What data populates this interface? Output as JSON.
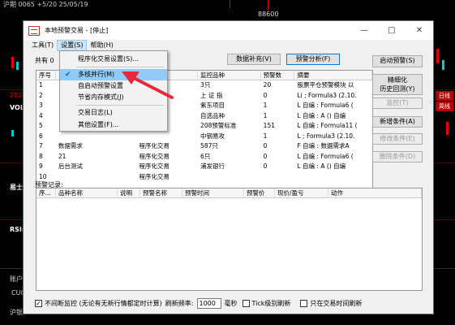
{
  "background": {
    "top_text": "沪期 0065 +5/20 25/05/19",
    "price": "88600",
    "label_2023": "2023",
    "vol_label": "VOL(",
    "ji_label": "易士1",
    "rsi_label": "RSI(",
    "zh_label": "账户拦",
    "cu_label": "CU06",
    "hu_label": "沪银2",
    "right_tags": [
      "日线",
      "周线"
    ]
  },
  "window": {
    "title": "本地预警交易 - [停止]",
    "minimize": "—",
    "maximize": "□",
    "close": "✕"
  },
  "menu": {
    "tools": "工具(T)",
    "settings": "设置(S)",
    "help": "帮助(H)"
  },
  "toolbar": {
    "count": "共有 0",
    "data_fill": "数据补充(V)",
    "alert_analysis": "预警分析(F)"
  },
  "right_buttons": {
    "start_alert": "启动预警(S)",
    "mesh_history": [
      "精细化",
      "历史回测(Y)"
    ],
    "monitor": "监控(T)",
    "add_condition": "新增条件(A)",
    "edit_condition": "修改条件(E)",
    "delete_condition": "删除条件(D)"
  },
  "dropdown": {
    "items": [
      {
        "label": "程序化交易设置(S)...",
        "checked": false
      },
      {
        "label": "多核并行(M)",
        "checked": true
      },
      {
        "label": "自启动预警设置",
        "checked": false
      },
      {
        "label": "节省内存模式(J)",
        "checked": false
      },
      {
        "label": "交易日志(L)",
        "checked": false
      },
      {
        "label": "其他设置(F)...",
        "checked": false
      }
    ]
  },
  "table1": {
    "headers": [
      "序号",
      "",
      "监控品种",
      "预警数",
      "摘要",
      ""
    ],
    "rows": [
      {
        "c1": "1",
        "c2": "",
        "c3": "",
        "c4": "3只",
        "c5": "20",
        "c6": "股票平仓预警模块 以"
      },
      {
        "c1": "2",
        "c2": "",
        "c3": "",
        "c4": "上 证 指",
        "c5": "0",
        "c6": "Li ; Formula3 (2.10."
      },
      {
        "c1": "3",
        "c2": "",
        "c3": "",
        "c4": "紫东项目",
        "c5": "1",
        "c6": "L 自编 : Formula6 ("
      },
      {
        "c1": "4",
        "c2": "",
        "c3": "",
        "c4": "自选品种",
        "c5": "1",
        "c6": "L 自编 : A () 自编"
      },
      {
        "c1": "5",
        "c2": "",
        "c3": "",
        "c4": "208预警标准",
        "c5": "151",
        "c6": "L 自编 : Formula11 ("
      },
      {
        "c1": "6",
        "c2": "",
        "c3": "",
        "c4": "中钢易攻",
        "c5": "1",
        "c6": "L ; Formula3 (2.10."
      },
      {
        "c1": "7",
        "c2": "数据需求",
        "c3": "程序化交易",
        "c4": "587只",
        "c5": "0",
        "c6": "F 自编 : 数据需求A"
      },
      {
        "c1": "8",
        "c2": "21",
        "c3": "程序化交易",
        "c4": "6只",
        "c5": "0",
        "c6": "L 自编 : Formula6 ("
      },
      {
        "c1": "9",
        "c2": "后台测试",
        "c3": "程序化交易",
        "c4": "浦发银行",
        "c5": "0",
        "c6": "L 自编 : A () 自编"
      },
      {
        "c1": "10",
        "c2": "",
        "c3": "程序化交易",
        "c4": "",
        "c5": "",
        "c6": ""
      }
    ]
  },
  "section2": {
    "label": "预警记录:",
    "headers": [
      "序...",
      "品种名称",
      "说明",
      "预警名称",
      "预警时间",
      "预警价",
      "现价/盈亏",
      "动作"
    ]
  },
  "footer": {
    "no_interval": "不间断监控 (无论有无新行情都定时计算)",
    "refresh_label": "刷新频率:",
    "refresh_value": "1000",
    "ms_label": "毫秒",
    "tick_label": "Tick级别刷新",
    "trade_time_label": "只在交易时间刷新"
  }
}
